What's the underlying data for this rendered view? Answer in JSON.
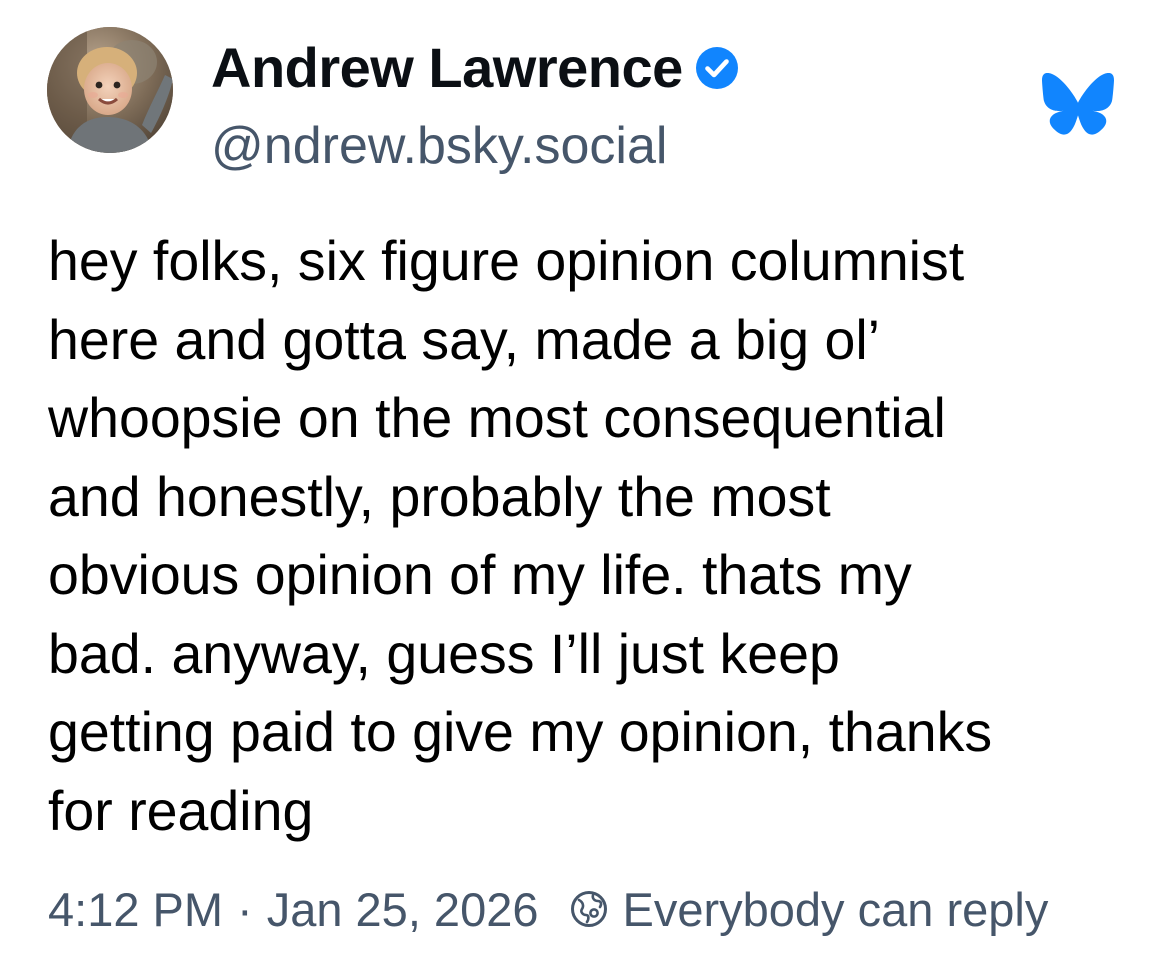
{
  "post": {
    "author": {
      "display_name": "Andrew Lawrence",
      "handle": "@ndrew.bsky.social",
      "verified": true,
      "avatar_icon": "avatar-child-photo"
    },
    "app_logo_icon": "bluesky-butterfly-icon",
    "text_lines": [
      "hey folks, six figure opinion columnist",
      "here and gotta say, made a big ol’",
      "whoopsie on the most consequential",
      "and honestly, probably the most",
      "obvious opinion of my life. thats my",
      "bad. anyway, guess I’ll just keep",
      "getting paid to give my opinion, thanks",
      "for reading"
    ],
    "timestamp": "4:12 PM",
    "separator": "·",
    "date": "Jan 25, 2026",
    "reply_setting_icon": "earth-globe-icon",
    "reply_setting": "Everybody can reply"
  },
  "colors": {
    "accent": "#1185fe",
    "secondary_text": "#46566a",
    "primary_text": "#000000"
  }
}
